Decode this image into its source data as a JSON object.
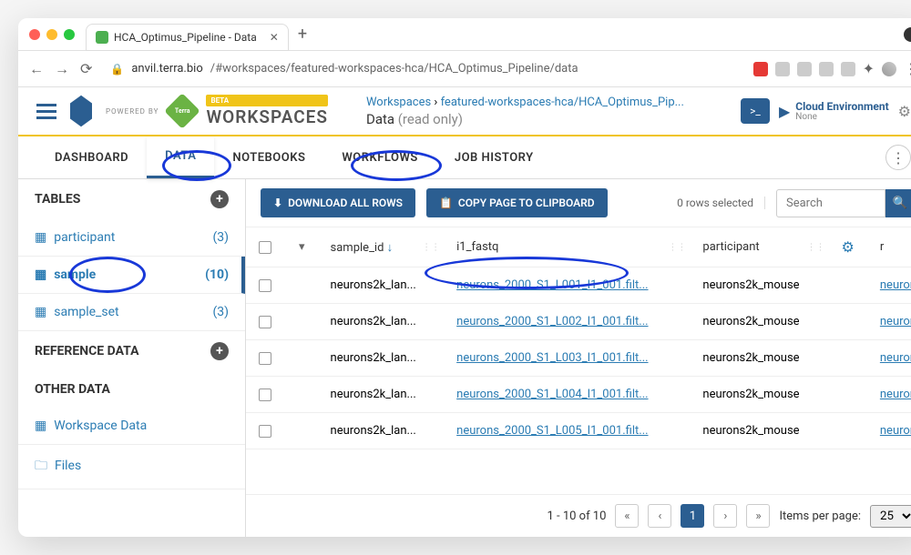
{
  "browser": {
    "tab_title": "HCA_Optimus_Pipeline - Data",
    "url_host": "anvil.terra.bio",
    "url_path": "/#workspaces/featured-workspaces-hca/HCA_Optimus_Pipeline/data"
  },
  "header": {
    "powered_by": "POWERED BY",
    "beta": "BETA",
    "workspaces": "WORKSPACES",
    "bc_workspaces": "Workspaces",
    "bc_sep": " › ",
    "bc_path": "featured-workspaces-hca/HCA_Optimus_Pip...",
    "bc_current": "Data",
    "read_only": "(read only)",
    "cloud_env": "Cloud Environment",
    "cloud_env_status": "None"
  },
  "tabs": {
    "dashboard": "DASHBOARD",
    "data": "DATA",
    "notebooks": "NOTEBOOKS",
    "workflows": "WORKFLOWS",
    "job_history": "JOB HISTORY"
  },
  "sidebar": {
    "tables": "TABLES",
    "ref_data": "REFERENCE DATA",
    "other_data": "OTHER DATA",
    "items": {
      "participant": {
        "label": "participant",
        "count": "(3)"
      },
      "sample": {
        "label": "sample",
        "count": "(10)"
      },
      "sample_set": {
        "label": "sample_set",
        "count": "(3)"
      },
      "workspace_data": {
        "label": "Workspace Data"
      },
      "files": {
        "label": "Files"
      }
    }
  },
  "toolbar": {
    "download": "DOWNLOAD ALL ROWS",
    "copy": "COPY PAGE TO CLIPBOARD",
    "rows_selected": "0 rows selected",
    "search_placeholder": "Search"
  },
  "table": {
    "cols": {
      "c1": "sample_id",
      "c2": "i1_fastq",
      "c3": "participant",
      "c4": "r"
    },
    "rows": [
      {
        "sid": "neurons2k_lan...",
        "fq": "neurons_2000_S1_L001_I1_001.filt...",
        "p": "neurons2k_mouse",
        "r": "neuron"
      },
      {
        "sid": "neurons2k_lan...",
        "fq": "neurons_2000_S1_L002_I1_001.filt...",
        "p": "neurons2k_mouse",
        "r": "neuron"
      },
      {
        "sid": "neurons2k_lan...",
        "fq": "neurons_2000_S1_L003_I1_001.filt...",
        "p": "neurons2k_mouse",
        "r": "neuron"
      },
      {
        "sid": "neurons2k_lan...",
        "fq": "neurons_2000_S1_L004_I1_001.filt...",
        "p": "neurons2k_mouse",
        "r": "neuron"
      },
      {
        "sid": "neurons2k_lan...",
        "fq": "neurons_2000_S1_L005_I1_001.filt...",
        "p": "neurons2k_mouse",
        "r": "neuron"
      }
    ]
  },
  "pager": {
    "range": "1 - 10 of 10",
    "page": "1",
    "ipp_label": "Items per page:",
    "ipp_value": "25"
  }
}
